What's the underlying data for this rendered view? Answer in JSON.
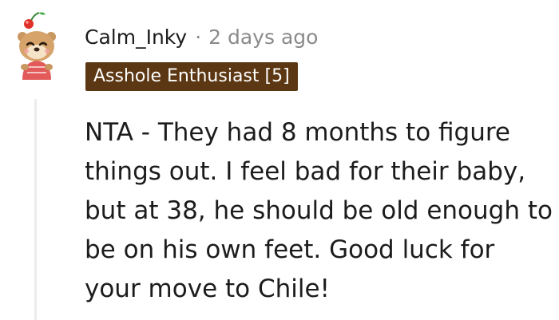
{
  "comment": {
    "username": "Calm_Inky",
    "separator": "·",
    "timestamp": "2 days ago",
    "flair": "Asshole Enthusiast [5]",
    "flair_color": "#5c3713",
    "body": "NTA - They had 8 months to figure things out. I feel bad for their baby, but at 38, he should be old enough to be on his own feet. Good luck for your move to Chile!",
    "avatar_icon": "otter-avatar-icon"
  }
}
